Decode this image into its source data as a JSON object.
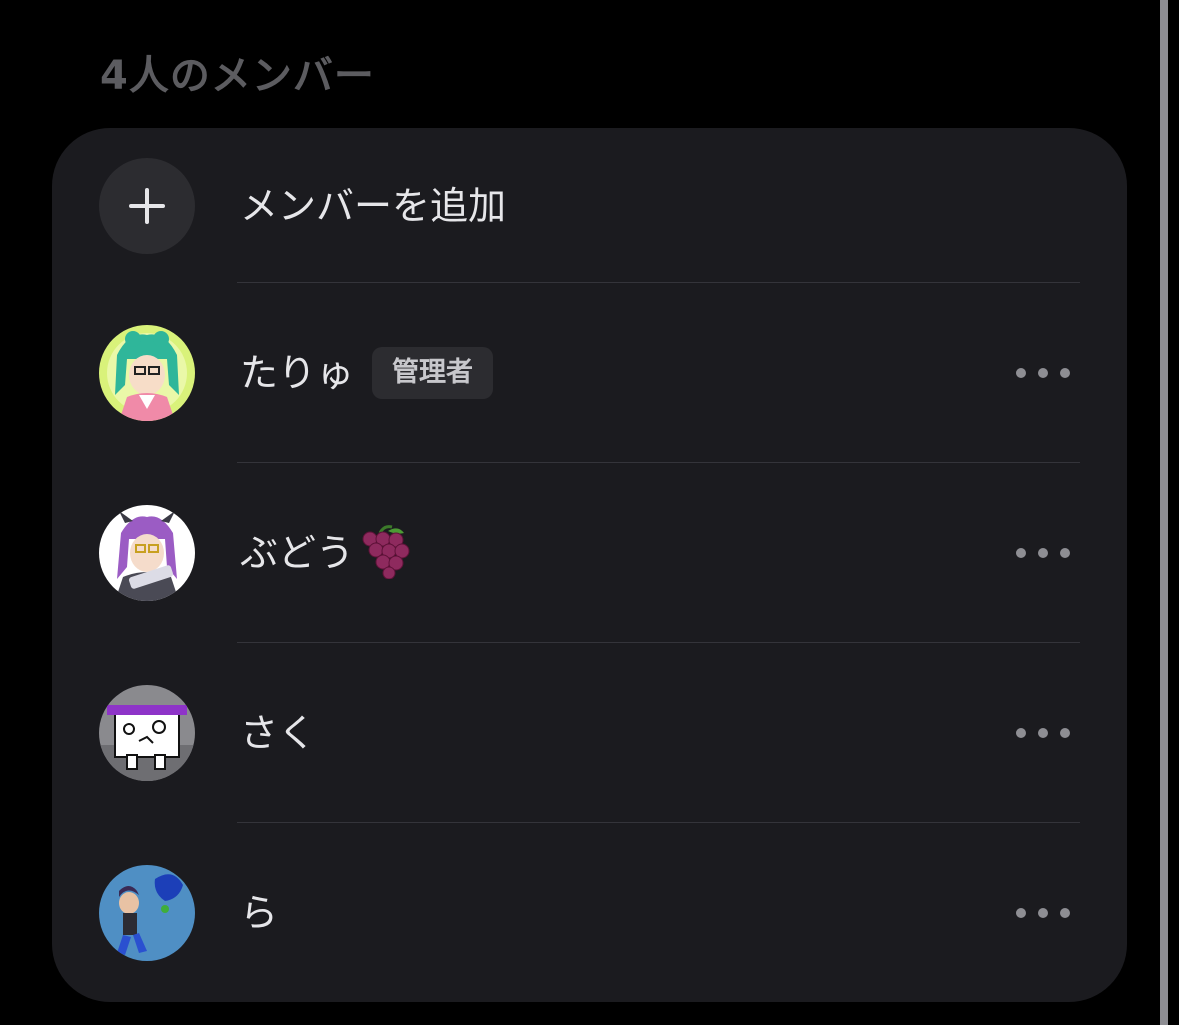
{
  "section": {
    "title": "4人のメンバー"
  },
  "add_member": {
    "label": "メンバーを追加",
    "icon": "plus-icon"
  },
  "members": [
    {
      "name": "たりゅ",
      "badge": "管理者",
      "avatar_icon": "avatar-squid-girl-green-icon"
    },
    {
      "name": "ぶどう",
      "emoji": "grape-icon",
      "avatar_icon": "avatar-squid-girl-purple-icon"
    },
    {
      "name": "さく",
      "avatar_icon": "avatar-box-character-icon"
    },
    {
      "name": "ら",
      "avatar_icon": "avatar-inkling-blue-icon"
    }
  ],
  "colors": {
    "background": "#000000",
    "card": "#1b1b1f",
    "text_primary": "#e6e6e9",
    "text_secondary": "#5c5c60",
    "divider": "#34343a",
    "badge_bg": "#2c2c30"
  }
}
